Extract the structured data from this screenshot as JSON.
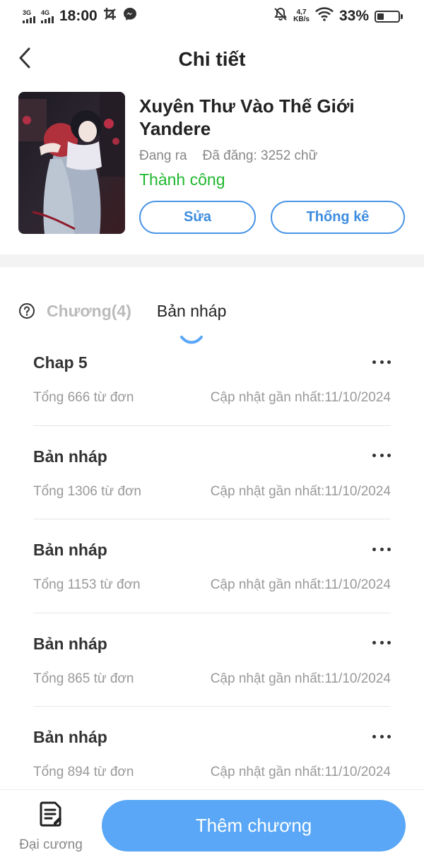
{
  "status_bar": {
    "network_1": "3G",
    "network_2": "4G",
    "time": "18:00",
    "speed_value": "4,7",
    "speed_unit": "KB/s",
    "battery": "33%",
    "battery_level": 0.33
  },
  "header": {
    "title": "Chi tiết"
  },
  "book": {
    "title": "Xuyên Thư Vào Thế Giới Yandere",
    "state": "Đang ra",
    "published": "Đã đăng: 3252 chữ",
    "result": "Thành công",
    "edit_label": "Sửa",
    "stats_label": "Thống kê"
  },
  "tabs": [
    {
      "label": "Chương(4)",
      "active": false
    },
    {
      "label": "Bản nháp",
      "active": true
    }
  ],
  "drafts": [
    {
      "title": "Chap 5",
      "words": "Tổng 666 từ đơn",
      "updated": "Cập nhật gần nhất:11/10/2024"
    },
    {
      "title": "Bản nháp",
      "words": "Tổng 1306 từ đơn",
      "updated": "Cập nhật gần nhất:11/10/2024"
    },
    {
      "title": "Bản nháp",
      "words": "Tổng 1153 từ đơn",
      "updated": "Cập nhật gần nhất:11/10/2024"
    },
    {
      "title": "Bản nháp",
      "words": "Tổng 865 từ đơn",
      "updated": "Cập nhật gần nhất:11/10/2024"
    },
    {
      "title": "Bản nháp",
      "words": "Tổng 894 từ đơn",
      "updated": "Cập nhật gần nhất:11/10/2024"
    }
  ],
  "bottom": {
    "outline_label": "Đại cương",
    "add_chapter_label": "Thêm chương"
  },
  "colors": {
    "accent": "#59a7f6",
    "button_border": "#4a94e6",
    "success": "#1fb82e"
  },
  "icons": {
    "back": "chevron-left-icon",
    "help": "question-circle-icon",
    "more": "more-horizontal-icon",
    "outline": "document-icon"
  }
}
